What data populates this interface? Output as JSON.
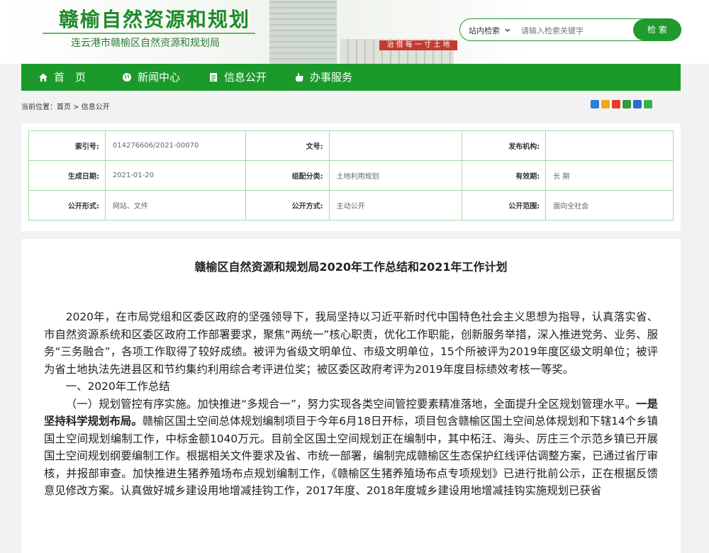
{
  "header": {
    "site_title": "赣榆自然资源和规划",
    "site_subtitle": "连云港市赣榆区自然资源和规划局",
    "building_banner": "治 借 每 一 寸 土 地",
    "search": {
      "scope": "站内检索",
      "placeholder": "请输入检索关键字",
      "button": "检 索"
    }
  },
  "nav": {
    "items": [
      {
        "label": "首　页",
        "icon": "home-icon"
      },
      {
        "label": "新闻中心",
        "icon": "globe-icon"
      },
      {
        "label": "信息公开",
        "icon": "document-icon"
      },
      {
        "label": "办事服务",
        "icon": "hand-icon"
      }
    ]
  },
  "breadcrumb": "当前位置：首页 > 信息公开",
  "share_icons": [
    "add-icon",
    "qzone-icon",
    "weibo-icon",
    "douban-icon",
    "renren-icon",
    "wechat-icon"
  ],
  "meta": {
    "index_label": "索引号:",
    "index_value": "014276606/2021-00070",
    "docno_label": "文号:",
    "docno_value": "",
    "publisher_label": "发布机构:",
    "publisher_value": "",
    "date_label": "生成日期:",
    "date_value": "2021-01-20",
    "category_label": "组配分类:",
    "category_value": "土地利用规划",
    "validity_label": "有效期:",
    "validity_value": "长 期",
    "form_label": "公开形式:",
    "form_value": "网站、文件",
    "mode_label": "公开方式:",
    "mode_value": "主动公开",
    "scope_label": "公开范围:",
    "scope_value": "面向全社会"
  },
  "article": {
    "title": "赣榆区自然资源和规划局2020年工作总结和2021年工作计划",
    "p1": "2020年，在市局党组和区委区政府的坚强领导下，我局坚持以习近平新时代中国特色社会主义思想为指导，认真落实省、市自然资源系统和区委区政府工作部署要求，聚焦“两统一”核心职责，优化工作职能，创新服务举措，深入推进党务、业务、服务“三务融合”，各项工作取得了较好成绩。被评为省级文明单位、市级文明单位，15个所被评为2019年度区级文明单位；被评为省土地执法先进县区和节约集约利用综合考评进位奖；被区委区政府考评为2019年度目标绩效考核一等奖。",
    "p2": "一、2020年工作总结",
    "p3_a": "（一）规划管控有序实施。加快推进“多规合一”，努力实现各类空间管控要素精准落地，全面提升全区规划管理水平。",
    "p3_bold": "一是坚持科学规划布局。",
    "p3_b": "赣榆区国土空间总体规划编制项目于今年6月18日开标，项目包含赣榆区国土空间总体规划和下辖14个乡镇国土空间规划编制工作，中标金额1040万元。目前全区国土空间规划正在编制中，其中柘汪、海头、厉庄三个示范乡镇已开展国土空间规划纲要编制工作。根据相关文件要求及省、市统一部署，编制完成赣榆区生态保护红线评估调整方案，已通过省厅审核，并报部审查。加快推进生猪养殖场布点规划编制工作，《赣榆区生猪养殖场布点专项规划》已进行批前公示，正在根据反馈意见修改方案。认真做好城乡建设用地增减挂钩工作，2017年度、2018年度城乡建设用地增减挂钩实施规划已获省"
  },
  "colors": {
    "brand_green": "#1b9a2b",
    "border_green": "#a8d8a8"
  }
}
